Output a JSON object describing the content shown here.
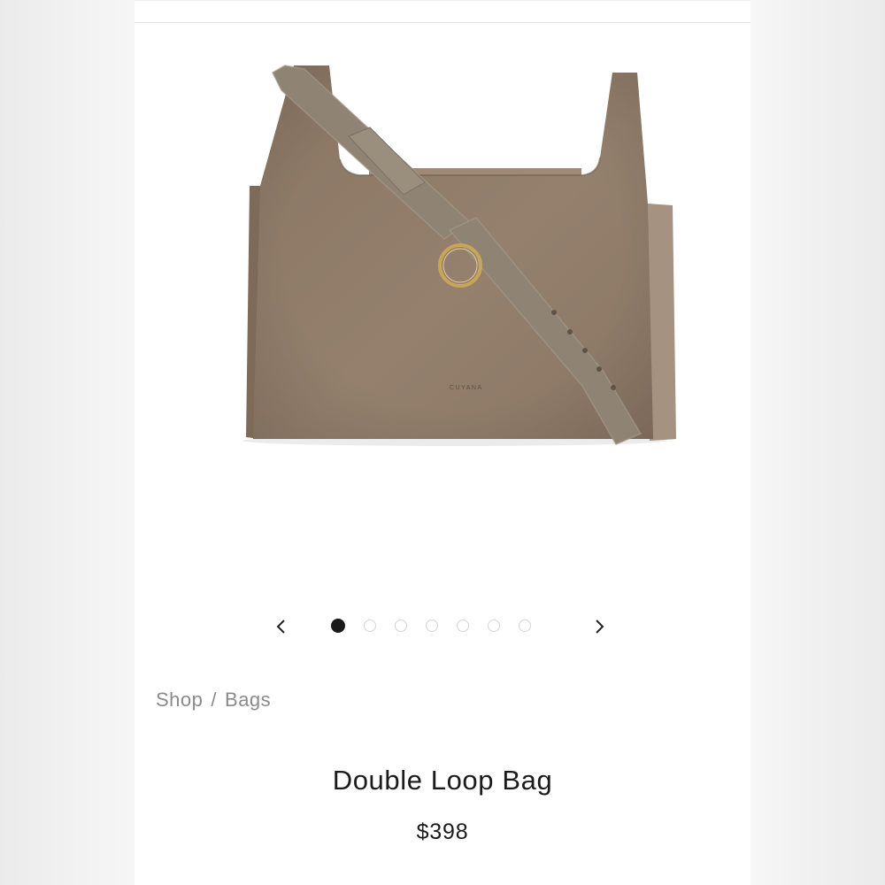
{
  "product": {
    "title": "Double Loop Bag",
    "price": "$398",
    "image_alt": "Double Loop Bag in taupe suede",
    "brand_stamp": "CUYANA"
  },
  "breadcrumb": {
    "items": [
      "Shop",
      "Bags"
    ],
    "separator": "/"
  },
  "carousel": {
    "prev_icon": "chevron-left-icon",
    "next_icon": "chevron-right-icon",
    "total_slides": 7,
    "active_index": 0
  },
  "colors": {
    "bag_suede": "#8e7865",
    "strap": "#8f8373",
    "ring": "#c9a55a",
    "text": "#1b1b1b",
    "muted": "#8a8a8a"
  }
}
